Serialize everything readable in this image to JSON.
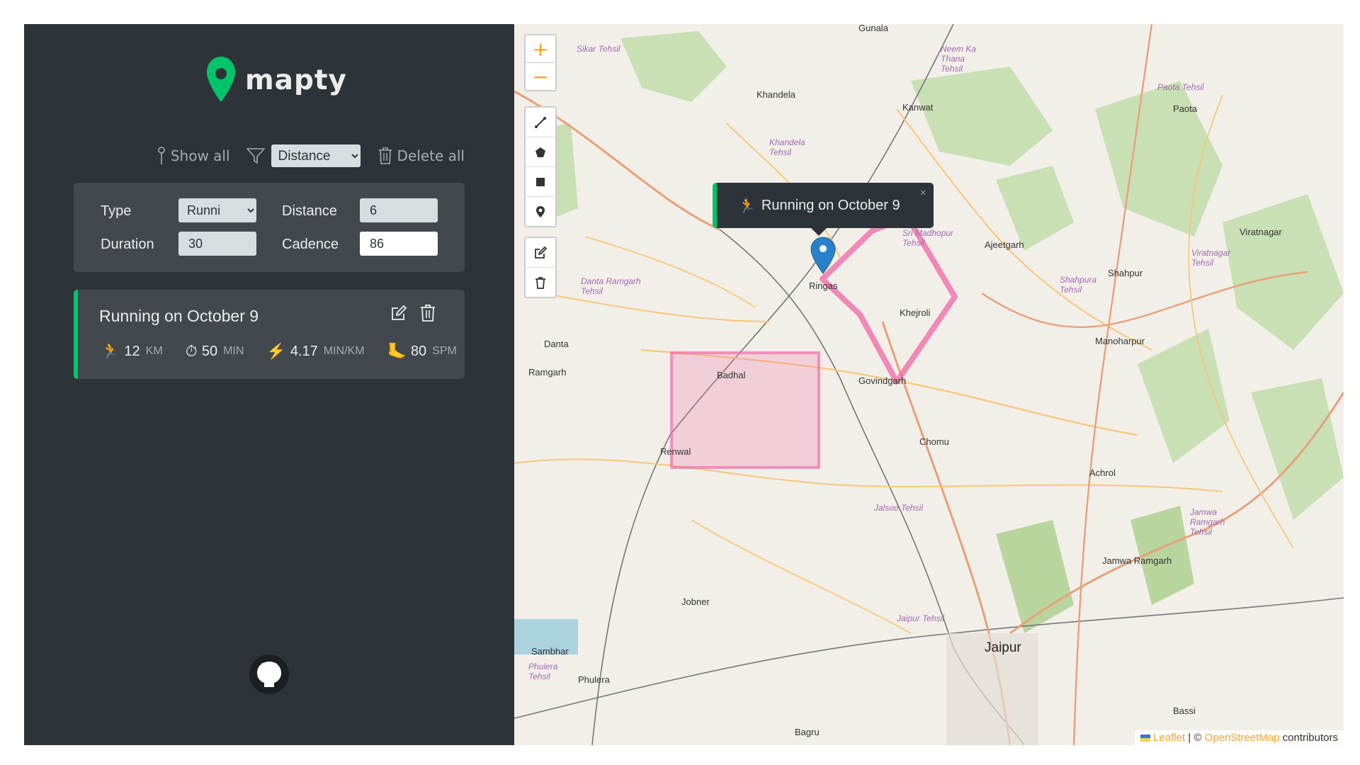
{
  "logo": {
    "text": "mapty"
  },
  "controls": {
    "show_all": "Show all",
    "sort_selected": "Distance",
    "sort_options": [
      "Distance"
    ],
    "delete_all": "Delete all"
  },
  "form": {
    "type_label": "Type",
    "type_value": "Runni",
    "distance_label": "Distance",
    "distance_value": "6",
    "duration_label": "Duration",
    "duration_value": "30",
    "cadence_label": "Cadence",
    "cadence_value": "86"
  },
  "workout": {
    "title": "Running on October 9",
    "distance": "12",
    "distance_unit": "KM",
    "duration": "50",
    "duration_unit": "MIN",
    "pace": "4.17",
    "pace_unit": "MIN/KM",
    "cadence": "80",
    "cadence_unit": "SPM"
  },
  "map": {
    "popup_text": "Running on October 9",
    "popup_close": "×",
    "zoom_in": "+",
    "zoom_out": "−",
    "attribution": {
      "leaflet": "Leaflet",
      "separator": " | © ",
      "osm": "OpenStreetMap",
      "suffix": " contributors"
    },
    "labels": {
      "gunala": "Gunala",
      "sikar": "Sikar Tehsil",
      "khandela": "Khandela",
      "kanwat": "Kanwat",
      "neemka": "Neem Ka Thana Tehsil",
      "paota_tehsil": "Paota Tehsil",
      "paota": "Paota",
      "khandela_tehsil": "Khandela Tehsil",
      "sri_madhopur": "Sri Madhopur Tehsil",
      "ajeetgarh": "Ajeetgarh",
      "viratnagar": "Viratnagar",
      "viratnagar_tehsil": "Viratnagar Tehsil",
      "shahpur": "Shahpur",
      "shahpura_tehsil": "Shahpura Tehsil",
      "danta_ramgarh": "Danta Ramgarh Tehsil",
      "ringas": "Ringas",
      "khejroli": "Khejroli",
      "manoharpur": "Manoharpur",
      "danta": "Danta",
      "ramgarh": "Ramgarh",
      "badhal": "Badhal",
      "govindgarh": "Govindgarh",
      "renwal": "Renwal",
      "chomu": "Chomu",
      "achrol": "Achrol",
      "jalsoo": "Jalsoo Tehsil",
      "jamwa_ramgarh_tehsil": "Jamwa Ramgarh Tehsil",
      "jamwa_ramgarh": "Jamwa Ramgarh",
      "jobner": "Jobner",
      "jaipur_tehsil": "Jaipur Tehsil",
      "jaipur": "Jaipur",
      "sambhar": "Sambhar",
      "phulera_tehsil": "Phulera Tehsil",
      "phulera": "Phulera",
      "bassi": "Bassi",
      "bagru": "Bagru"
    }
  },
  "colors": {
    "sidebar_bg": "#2d3439",
    "card_bg": "#42484d",
    "accent_green": "#00c46a",
    "shape_pink": "#f06ea9",
    "zoom_orange": "#f5a623",
    "marker_blue": "#2a81cb"
  }
}
